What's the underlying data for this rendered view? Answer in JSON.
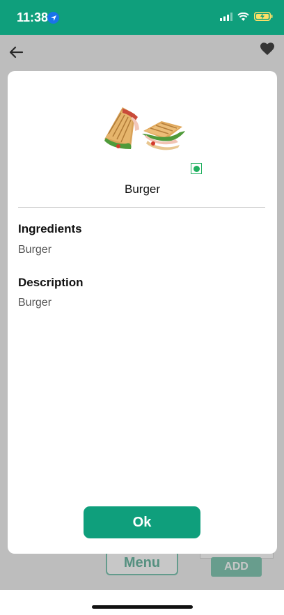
{
  "status_bar": {
    "time": "11:38"
  },
  "background_page": {
    "menu_label": "Menu",
    "add_label": "ADD"
  },
  "modal": {
    "item_name": "Burger",
    "ingredients_heading": "Ingredients",
    "ingredients_text": "Burger",
    "description_heading": "Description",
    "description_text": "Burger",
    "ok_label": "Ok"
  },
  "colors": {
    "accent": "#0f9f7c",
    "veg_indicator": "#21b060"
  },
  "icons": [
    "location-arrow-icon",
    "signal-icon",
    "wifi-icon",
    "battery-charging-icon",
    "back-arrow-icon",
    "heart-icon",
    "veg-indicator-icon"
  ]
}
